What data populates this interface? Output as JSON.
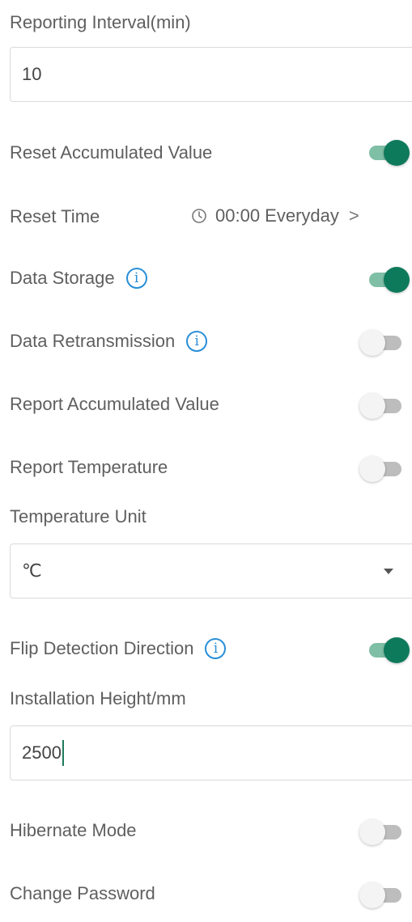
{
  "reporting_interval": {
    "label": "Reporting Interval(min)",
    "value": "10"
  },
  "reset_accumulated_value": {
    "label": "Reset Accumulated Value",
    "enabled": true
  },
  "reset_time": {
    "label": "Reset Time",
    "value": "00:00 Everyday",
    "icon": "clock-icon",
    "chevron": ">"
  },
  "data_storage": {
    "label": "Data Storage",
    "info_symbol": "i",
    "enabled": true
  },
  "data_retransmission": {
    "label": "Data Retransmission",
    "info_symbol": "i",
    "enabled": false
  },
  "report_accumulated_value": {
    "label": "Report Accumulated Value",
    "enabled": false
  },
  "report_temperature": {
    "label": "Report Temperature",
    "enabled": false
  },
  "temperature_unit": {
    "label": "Temperature Unit",
    "selected": "℃"
  },
  "flip_detection_direction": {
    "label": "Flip Detection Direction",
    "info_symbol": "i",
    "enabled": true
  },
  "installation_height": {
    "label": "Installation Height/mm",
    "value": "2500"
  },
  "hibernate_mode": {
    "label": "Hibernate Mode",
    "enabled": false
  },
  "change_password": {
    "label": "Change Password",
    "enabled": false
  },
  "colors": {
    "toggle_on_knob": "#0e7a5c",
    "toggle_on_track": "#7fbfa6",
    "toggle_off_track": "#bdbdbd",
    "info_icon": "#2a8fd8"
  }
}
